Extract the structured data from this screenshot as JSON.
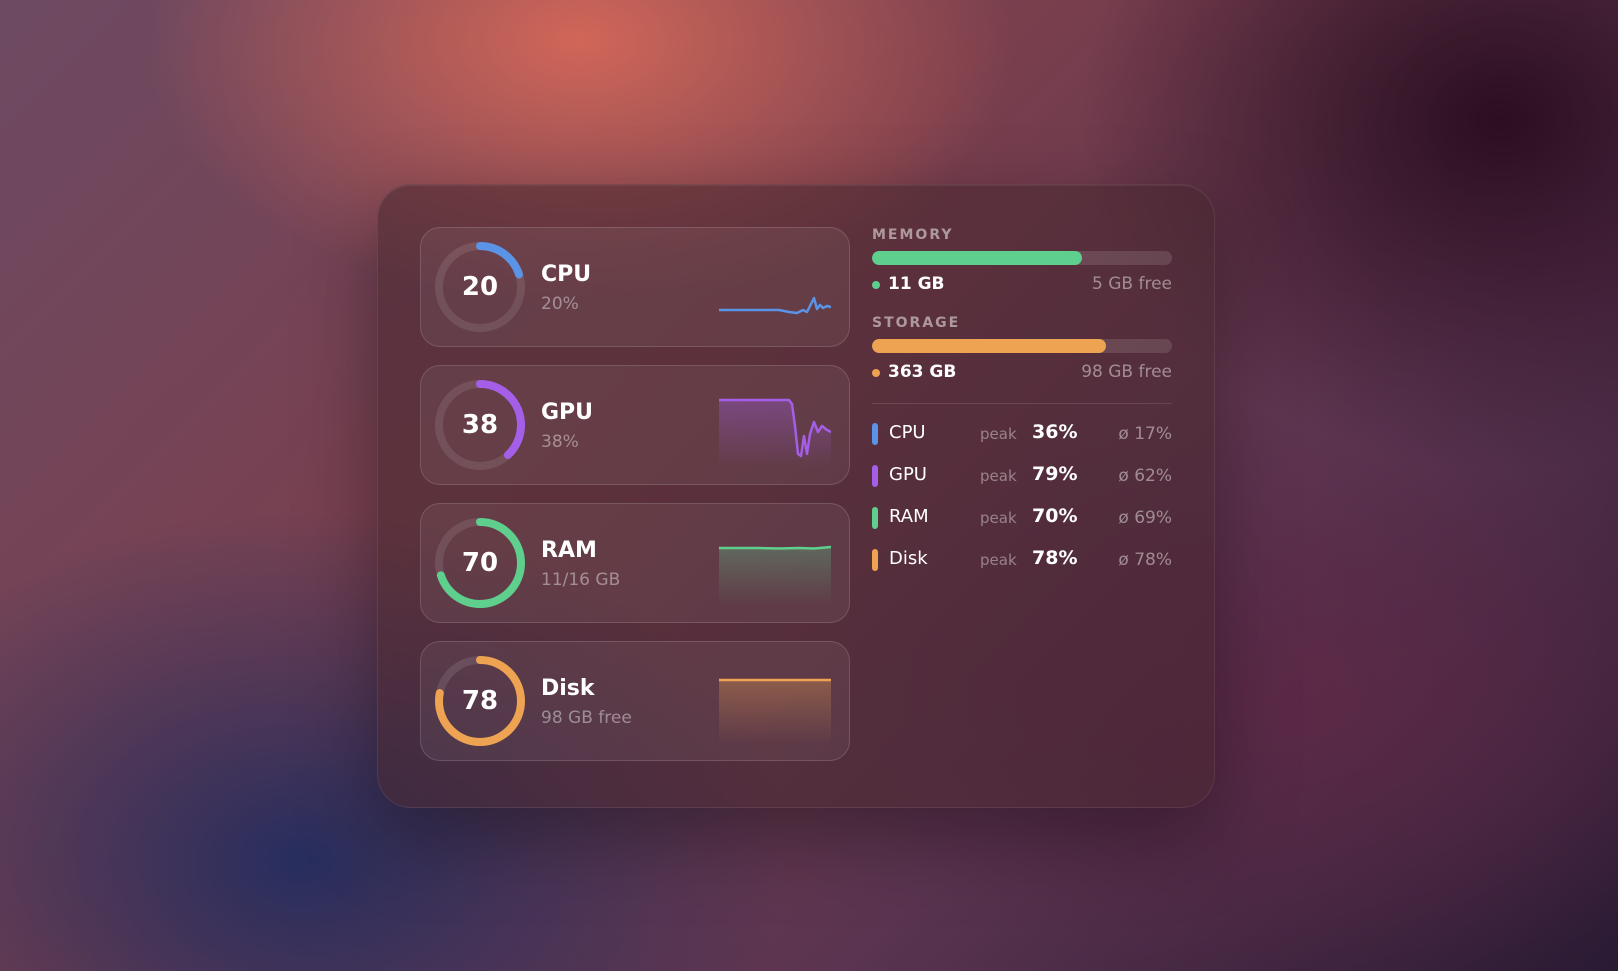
{
  "colors": {
    "cpu": "#5b93e6",
    "gpu": "#a45ee8",
    "ram": "#5fcf8e",
    "disk": "#eea352"
  },
  "cards": [
    {
      "key": "cpu",
      "value": "20",
      "percent": 20,
      "title": "CPU",
      "subtitle": "20%",
      "color": "#5b93e6"
    },
    {
      "key": "gpu",
      "value": "38",
      "percent": 38,
      "title": "GPU",
      "subtitle": "38%",
      "color": "#a45ee8"
    },
    {
      "key": "ram",
      "value": "70",
      "percent": 70,
      "title": "RAM",
      "subtitle": "11/16 GB",
      "color": "#5fcf8e"
    },
    {
      "key": "disk",
      "value": "78",
      "percent": 78,
      "title": "Disk",
      "subtitle": "98 GB free",
      "color": "#eea352"
    }
  ],
  "memory": {
    "label": "MEMORY",
    "used": "11 GB",
    "free": "5 GB free",
    "fill_fraction": 0.7,
    "color": "#5fcf8e"
  },
  "storage": {
    "label": "STORAGE",
    "used": "363 GB",
    "free": "98 GB free",
    "fill_fraction": 0.78,
    "color": "#eea352"
  },
  "stats": [
    {
      "name": "CPU",
      "peak_label": "peak",
      "peak": "36%",
      "avg": "ø 17%",
      "color": "#5b93e6"
    },
    {
      "name": "GPU",
      "peak_label": "peak",
      "peak": "79%",
      "avg": "ø 62%",
      "color": "#a45ee8"
    },
    {
      "name": "RAM",
      "peak_label": "peak",
      "peak": "70%",
      "avg": "ø 69%",
      "color": "#5fcf8e"
    },
    {
      "name": "Disk",
      "peak_label": "peak",
      "peak": "78%",
      "avg": "ø 78%",
      "color": "#eea352"
    }
  ]
}
